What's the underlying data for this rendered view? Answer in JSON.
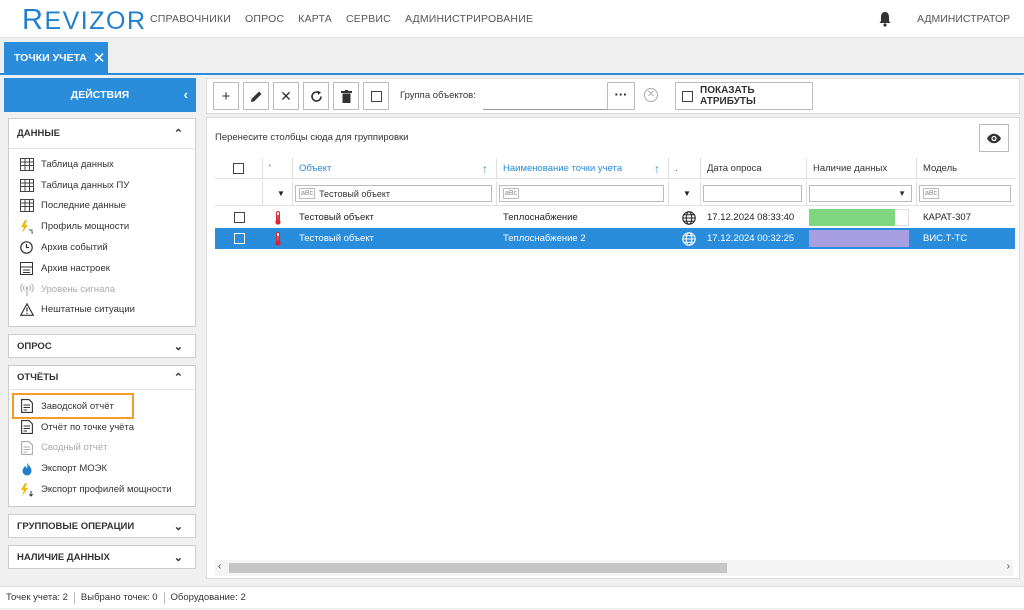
{
  "app": {
    "logo_big": "R",
    "logo_rest": "EVIZOR",
    "nav": [
      "СПРАВОЧНИКИ",
      "ОПРОС",
      "КАРТА",
      "СЕРВИС",
      "АДМИНИСТРИРОВАНИЕ"
    ],
    "user": "АДМИНИСТРАТОР",
    "accent": "#2a8ddc"
  },
  "tab": {
    "label": "ТОЧКИ УЧЕТА",
    "close": "✕"
  },
  "actions": {
    "label": "ДЕЙСТВИЯ",
    "chevron": "‹"
  },
  "toolbar": {
    "group_label": "Группа объектов:",
    "group_value": "",
    "dots": "···",
    "show_attributes": "ПОКАЗАТЬ АТРИБУТЫ"
  },
  "sidebar": {
    "data_section": {
      "title": "ДАННЫЕ",
      "items": [
        {
          "label": "Таблица данных",
          "icon": "table-icon",
          "disabled": false
        },
        {
          "label": "Таблица данных ПУ",
          "icon": "table-icon",
          "disabled": false
        },
        {
          "label": "Последние данные",
          "icon": "table-icon",
          "disabled": false
        },
        {
          "label": "Профиль мощности",
          "icon": "power-profile-icon",
          "disabled": false
        },
        {
          "label": "Архив событий",
          "icon": "clock-icon",
          "disabled": false
        },
        {
          "label": "Архив настроек",
          "icon": "settings-archive-icon",
          "disabled": false
        },
        {
          "label": "Уровень сигнала",
          "icon": "signal-icon",
          "disabled": true
        },
        {
          "label": "Нештатные ситуации",
          "icon": "warning-icon",
          "disabled": false
        }
      ]
    },
    "poll_section": {
      "title": "ОПРОС"
    },
    "reports_section": {
      "title": "ОТЧЁТЫ",
      "items": [
        {
          "label": "Заводской отчёт",
          "icon": "report-icon",
          "disabled": false
        },
        {
          "label": "Отчёт по точке учёта",
          "icon": "report-icon",
          "disabled": false
        },
        {
          "label": "Сводный отчёт",
          "icon": "report-icon",
          "disabled": true
        },
        {
          "label": "Экспорт МОЭК",
          "icon": "flame-icon",
          "disabled": false
        },
        {
          "label": "Экспорт профилей мощности",
          "icon": "power-export-icon",
          "disabled": false
        }
      ]
    },
    "group_ops_section": {
      "title": "ГРУППОВЫЕ ОПЕРАЦИИ"
    },
    "data_avail_section": {
      "title": "НАЛИЧИЕ ДАННЫХ"
    }
  },
  "grid": {
    "group_hint": "Перенесите столбцы сюда для группировки",
    "columns": [
      "",
      "'",
      "Объект",
      "Наименование точки учета",
      ".",
      "Дата опроса",
      "Наличие данных",
      "Модель"
    ],
    "filters": {
      "object": "Тестовый объект",
      "abc": "aBc"
    },
    "rows": [
      {
        "object": "Тестовый объект",
        "name": "Теплоснабжение",
        "date": "17.12.2024 08:33:40",
        "data_color": "#7ed67e",
        "data_fill": 0.86,
        "model": "КАРАТ-307",
        "selected": false
      },
      {
        "object": "Тестовый объект",
        "name": "Теплоснабжение 2",
        "date": "17.12.2024 00:32:25",
        "data_color": "#a79fe0",
        "data_fill": 1.0,
        "model": "ВИС.Т-ТС",
        "selected": true
      }
    ]
  },
  "status": {
    "points": "Точек учета: 2",
    "selected": "Выбрано точек: 0",
    "equipment": "Оборудование: 2"
  }
}
